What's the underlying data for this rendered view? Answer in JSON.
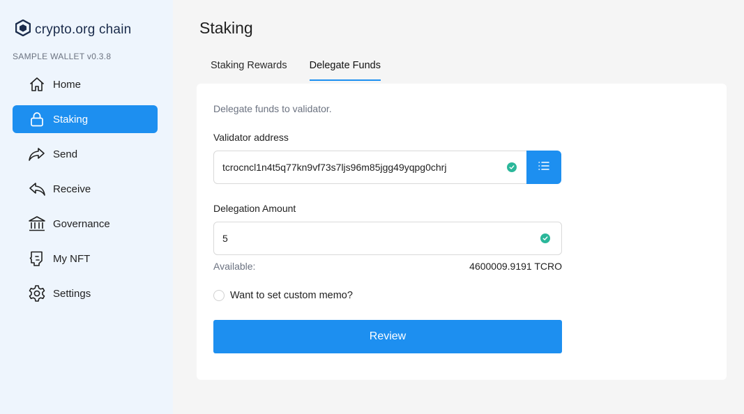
{
  "app": {
    "brand": "crypto.org chain",
    "version": "SAMPLE WALLET v0.3.8"
  },
  "sidebar": {
    "items": [
      {
        "label": "Home",
        "icon": "home-icon",
        "active": false
      },
      {
        "label": "Staking",
        "icon": "lock-icon",
        "active": true
      },
      {
        "label": "Send",
        "icon": "send-icon",
        "active": false
      },
      {
        "label": "Receive",
        "icon": "receive-icon",
        "active": false
      },
      {
        "label": "Governance",
        "icon": "bank-icon",
        "active": false
      },
      {
        "label": "My NFT",
        "icon": "nft-icon",
        "active": false
      },
      {
        "label": "Settings",
        "icon": "gear-icon",
        "active": false
      }
    ]
  },
  "page": {
    "title": "Staking",
    "tabs": [
      {
        "label": "Staking Rewards",
        "active": false
      },
      {
        "label": "Delegate Funds",
        "active": true
      }
    ]
  },
  "form": {
    "description": "Delegate funds to validator.",
    "validator_label": "Validator address",
    "validator_value": "tcrocncl1n4t5q77kn9vf73s7ljs96m85jgg49yqpg0chrj",
    "amount_label": "Delegation Amount",
    "amount_value": "5",
    "available_label": "Available:",
    "available_value": "4600009.9191 TCRO",
    "memo_label": "Want to set custom memo?",
    "review_label": "Review"
  },
  "colors": {
    "accent": "#1d8ff0",
    "sidebar_bg": "#eef5fd",
    "valid": "#2bb79a"
  }
}
